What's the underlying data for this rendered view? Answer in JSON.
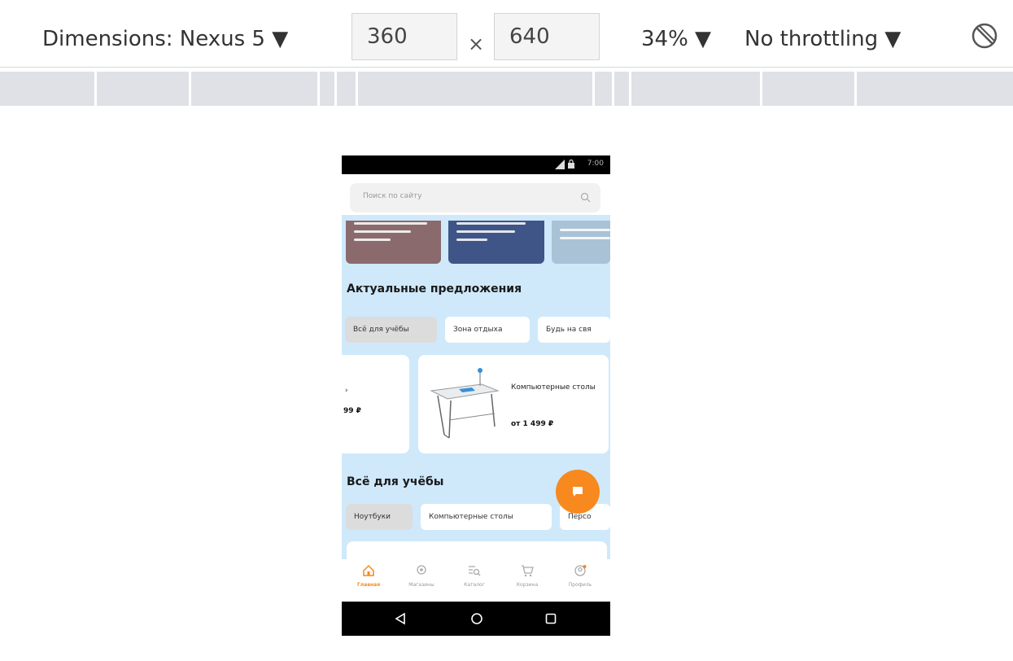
{
  "toolbar": {
    "dimensions_label": "Dimensions: Nexus 5 ▼",
    "width_value": "360",
    "times": "×",
    "height_value": "640",
    "zoom": "34% ▼",
    "throttling": "No throttling ▼"
  },
  "phone": {
    "status_time": "7:00",
    "search_placeholder": "Поиск по сайту",
    "section1_title": "Актуальные предложения",
    "chips1": [
      "Всё для учёбы",
      "Зона отдыха",
      "Будь на свя"
    ],
    "card1_price": "99 ₽",
    "card2_title": "Компьютерные столы",
    "card2_price": "от 1 499 ₽",
    "section2_title": "Всё для учёбы",
    "chips2": [
      "Ноутбуки",
      "Компьютерные столы",
      "Персо"
    ],
    "nav": [
      "Главная",
      "Магазины",
      "Каталог",
      "Корзина",
      "Профиль"
    ]
  },
  "colors": {
    "accent": "#f7891f",
    "page_bg": "#cfe9fb",
    "banner1": "#8b6a6d",
    "banner2": "#3f5588",
    "banner3": "#a9c2d6"
  }
}
